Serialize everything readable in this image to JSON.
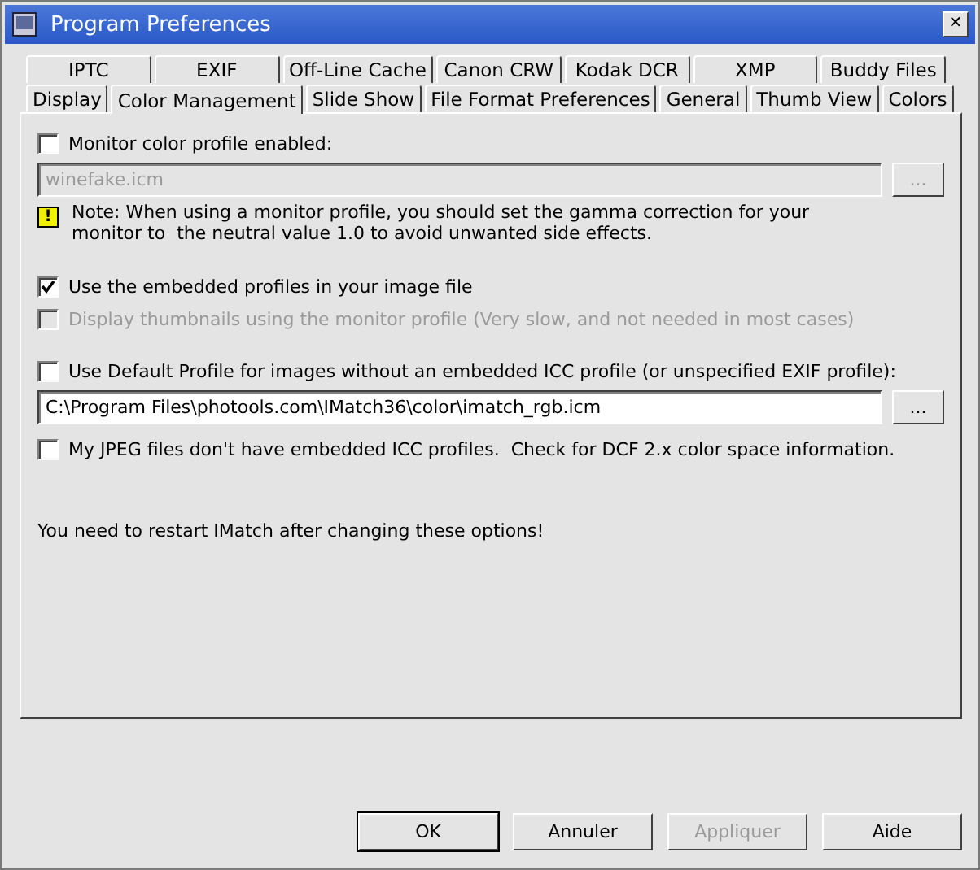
{
  "window": {
    "title": "Program Preferences",
    "close": "✕"
  },
  "tab_rows": [
    [
      {
        "label": "IPTC",
        "selected": false
      },
      {
        "label": "EXIF",
        "selected": false
      },
      {
        "label": "Off-Line Cache",
        "selected": false
      },
      {
        "label": "Canon CRW",
        "selected": false
      },
      {
        "label": "Kodak DCR",
        "selected": false
      },
      {
        "label": "XMP",
        "selected": false
      },
      {
        "label": "Buddy Files",
        "selected": false
      }
    ],
    [
      {
        "label": "Display",
        "selected": false
      },
      {
        "label": "Color Management",
        "selected": true
      },
      {
        "label": "Slide Show",
        "selected": false
      },
      {
        "label": "File Format Preferences",
        "selected": false
      },
      {
        "label": "General",
        "selected": false
      },
      {
        "label": "Thumb View",
        "selected": false
      },
      {
        "label": "Colors",
        "selected": false
      }
    ]
  ],
  "panel": [
    {
      "kind": "checkbox",
      "label": "Monitor color profile enabled:",
      "checked": false,
      "disabled": false
    },
    {
      "kind": "path",
      "value": "winefake.icm",
      "disabled": true,
      "button": "..."
    },
    {
      "kind": "note",
      "glyph": "!",
      "text": "Note: When using a monitor profile, you should set the gamma correction for your monitor to  the neutral value 1.0 to avoid unwanted side effects."
    },
    {
      "kind": "checkbox",
      "label": "Use the embedded profiles in your image file",
      "checked": true,
      "disabled": false
    },
    {
      "kind": "checkbox",
      "label": "Display thumbnails using the monitor profile (Very slow, and not needed in most cases)",
      "checked": false,
      "disabled": true
    },
    {
      "kind": "checkbox",
      "label": "Use Default Profile for images without an embedded ICC profile (or unspecified EXIF profile):",
      "checked": false,
      "disabled": false
    },
    {
      "kind": "path",
      "value": "C:\\Program Files\\photools.com\\IMatch36\\color\\imatch_rgb.icm",
      "disabled": false,
      "button": "..."
    },
    {
      "kind": "checkbox",
      "label": "My JPEG files don't have embedded ICC profiles.  Check for DCF 2.x color space information.",
      "checked": false,
      "disabled": false
    },
    {
      "kind": "text",
      "text": "You need to restart IMatch after changing these options!"
    }
  ],
  "buttons": [
    {
      "label": "OK",
      "default": true,
      "disabled": false
    },
    {
      "label": "Annuler",
      "default": false,
      "disabled": false
    },
    {
      "label": "Appliquer",
      "default": false,
      "disabled": true
    },
    {
      "label": "Aide",
      "default": false,
      "disabled": false
    }
  ]
}
